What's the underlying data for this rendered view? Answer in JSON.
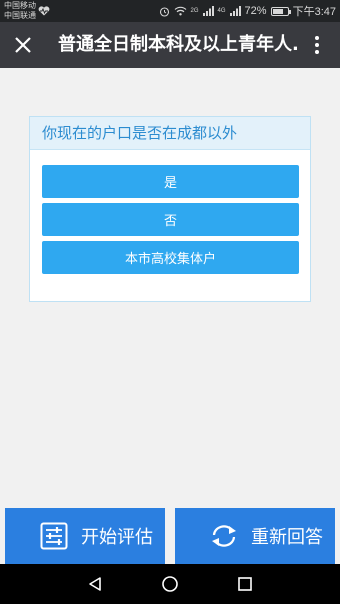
{
  "status_bar": {
    "carrier_1": "中国移动",
    "carrier_2": "中国联通",
    "network_1": "2G",
    "network_2": "4G",
    "battery": "72%",
    "battery_level": 0.72,
    "time": "下午3:47"
  },
  "title_bar": {
    "title": "普通全日制本科及以上青年人..."
  },
  "question": {
    "text": "你现在的户口是否在成都以外",
    "options": [
      {
        "label": "是"
      },
      {
        "label": "否"
      },
      {
        "label": "本市高校集体户"
      }
    ]
  },
  "actions": {
    "start_label": "开始评估",
    "restart_label": "重新回答"
  },
  "colors": {
    "title_bar": "#393a3f",
    "option": "#2fa8f0",
    "action": "#2b7fe0",
    "question_text": "#2c8cd0"
  }
}
